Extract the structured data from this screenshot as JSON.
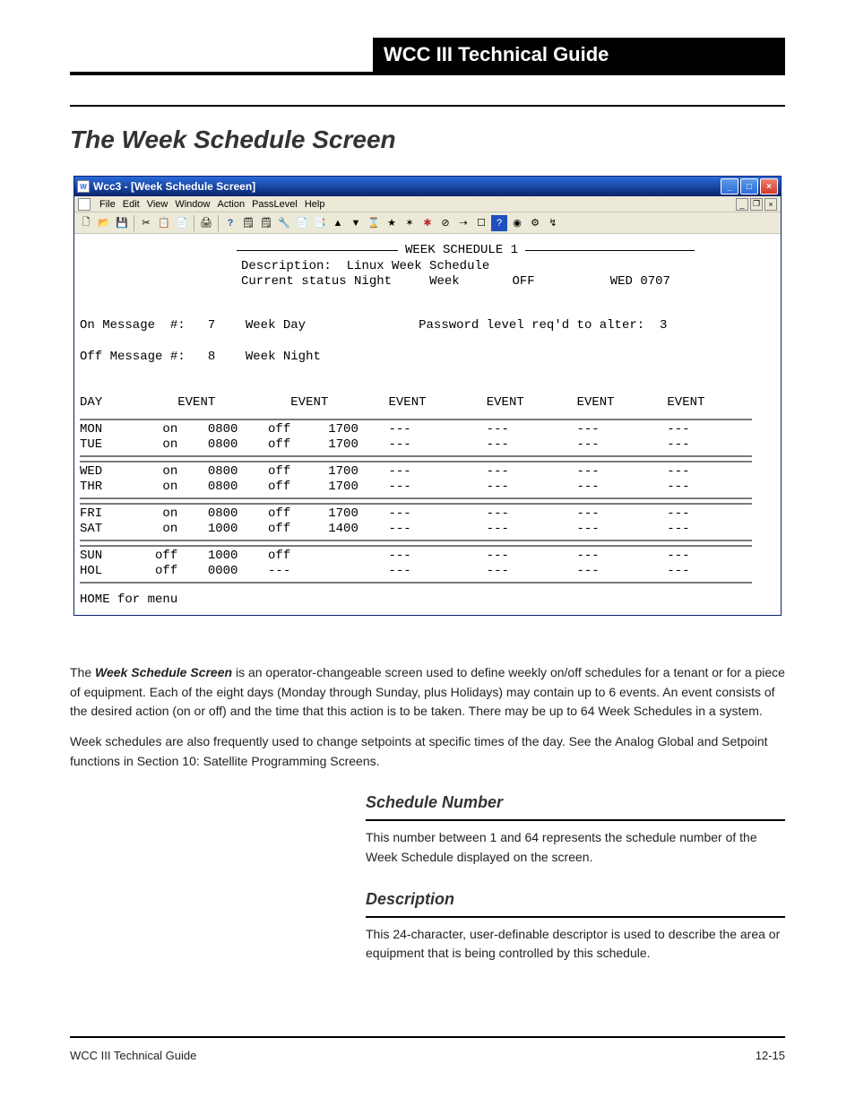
{
  "doc": {
    "top_right_label": "WCC III Technical Guide",
    "section_heading": "The Week Schedule Screen",
    "footer_left": "WCC III Technical Guide",
    "footer_right": "12-15"
  },
  "window": {
    "title": "Wcc3 - [Week Schedule Screen]",
    "menu": [
      "File",
      "Edit",
      "View",
      "Window",
      "Action",
      "PassLevel",
      "Help"
    ]
  },
  "header": {
    "banner": "WEEK SCHEDULE 1",
    "desc_label": "Description:",
    "desc_value": "Linux Week Schedule",
    "status_label": "Current status",
    "status_value": "Night",
    "week_label": "Week",
    "off_label": "OFF",
    "datetime": "WED 0707"
  },
  "messages": {
    "on_label": "On Message  #:",
    "on_num": "7",
    "on_text": "Week Day",
    "off_label": "Off Message #:",
    "off_num": "8",
    "off_text": "Week Night",
    "pw_label": "Password level req'd to alter:",
    "pw_value": "3"
  },
  "columns": {
    "day": "DAY",
    "event": "EVENT"
  },
  "schedule": [
    [
      {
        "day": "MON",
        "e1s": "on",
        "e1t": "0800",
        "e2s": "off",
        "e2t": "1700"
      },
      {
        "day": "TUE",
        "e1s": "on",
        "e1t": "0800",
        "e2s": "off",
        "e2t": "1700"
      }
    ],
    [
      {
        "day": "WED",
        "e1s": "on",
        "e1t": "0800",
        "e2s": "off",
        "e2t": "1700"
      },
      {
        "day": "THR",
        "e1s": "on",
        "e1t": "0800",
        "e2s": "off",
        "e2t": "1700"
      }
    ],
    [
      {
        "day": "FRI",
        "e1s": "on",
        "e1t": "0800",
        "e2s": "off",
        "e2t": "1700"
      },
      {
        "day": "SAT",
        "e1s": "on",
        "e1t": "1000",
        "e2s": "off",
        "e2t": "1400"
      }
    ],
    [
      {
        "day": "SUN",
        "e1s": "off",
        "e1t": "1000",
        "e2s": "off",
        "e2t": ""
      },
      {
        "day": "HOL",
        "e1s": "off",
        "e1t": "0000",
        "e2s": "---",
        "e2t": ""
      }
    ]
  ],
  "placeholder": "---",
  "footer_note": "HOME for menu",
  "body": {
    "p1a": "The ",
    "p1b": "Week Schedule Screen",
    "p1c": " is an operator-changeable screen used to define weekly on/off schedules for a tenant or for a piece of equipment. Each of the eight days (Monday through Sunday, plus Holidays) may contain up to 6 events. An event consists of the desired action (on or off) and the time that this action is to be taken. There may be up to 64 Week Schedules in a system.",
    "p2": "Week schedules are also frequently used to change setpoints at specific times of the day. See the Analog Global and Setpoint functions in Section 10: Satellite Programming Screens.",
    "f1_title": "Schedule Number",
    "f1_desc": "This number between 1 and 64 represents the schedule number of the Week Schedule displayed on the screen.",
    "f2_title": "Description",
    "f2_desc": "This 24-character, user-definable descriptor is used to describe the area or equipment that is being controlled by this schedule."
  }
}
